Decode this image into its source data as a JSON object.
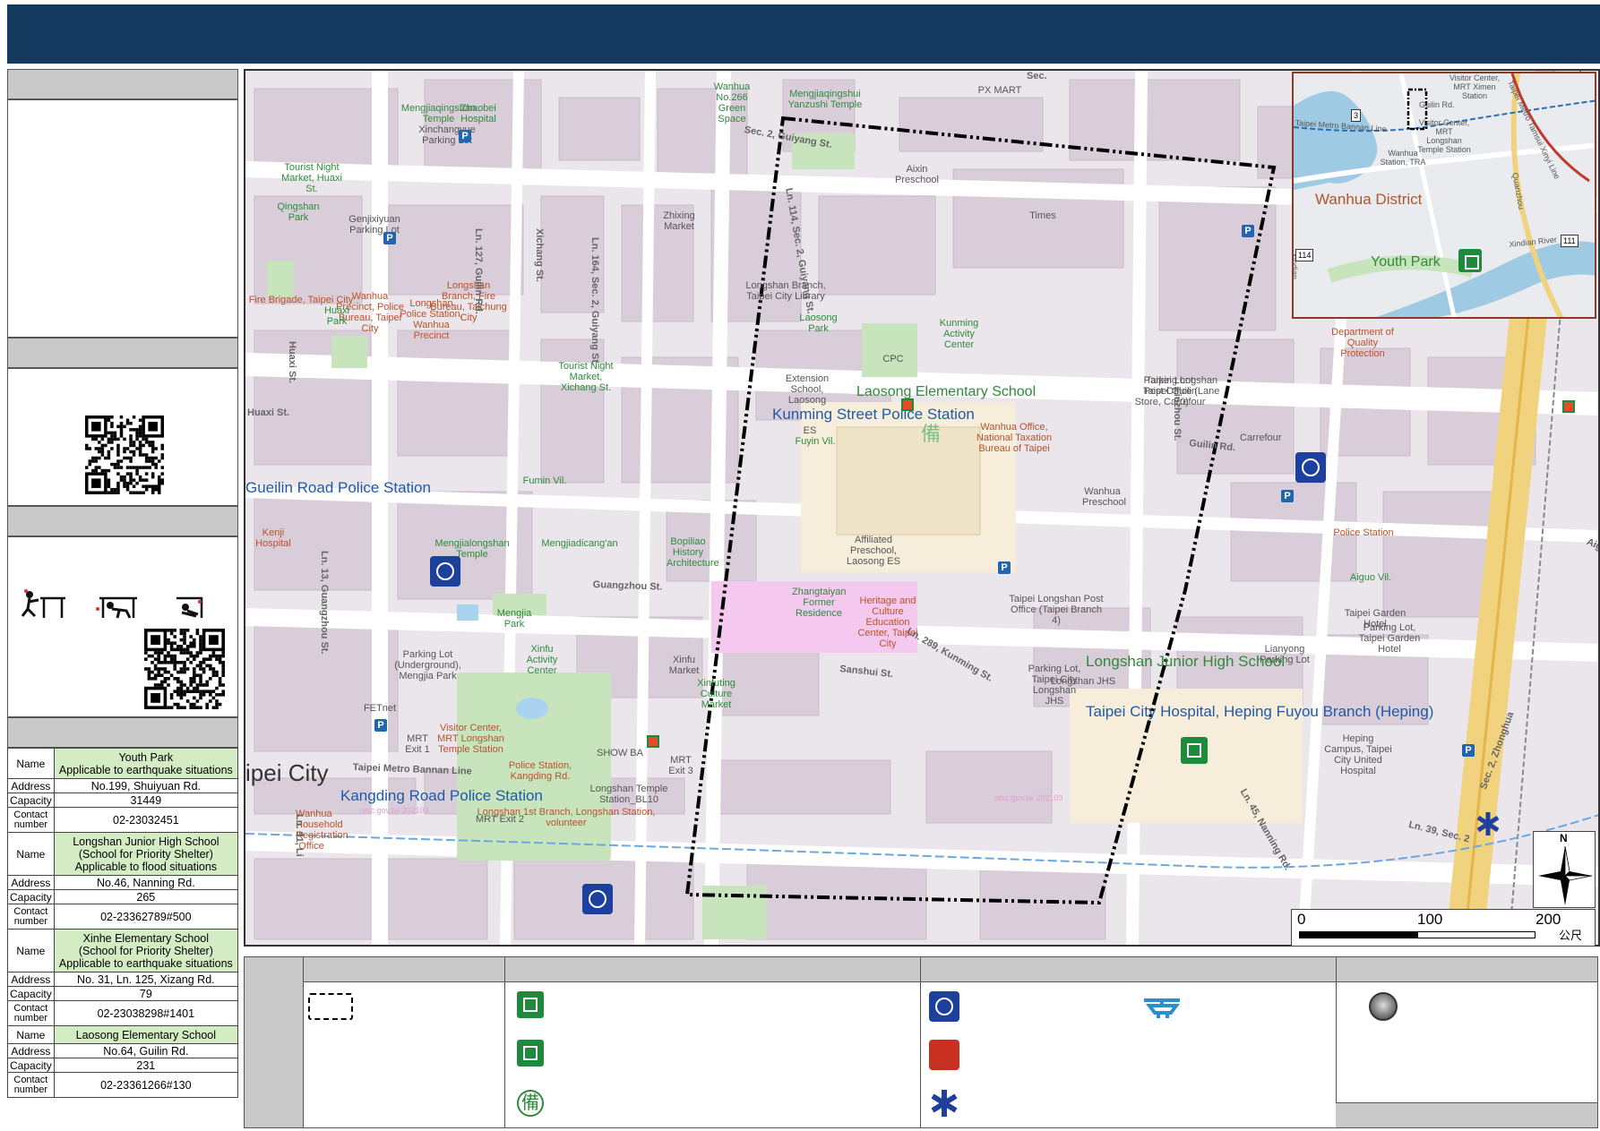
{
  "map": {
    "small_labels": [
      {
        "text": "Mengjiaqingshan Temple",
        "cls": "green"
      },
      {
        "text": "Zhaobei Hospital",
        "cls": "green"
      },
      {
        "text": "Wanhua No.266 Green Space",
        "cls": "green"
      },
      {
        "text": "Mengjiaqingshui Yanzushi Temple",
        "cls": "green"
      },
      {
        "text": "PX MART",
        "cls": "gray"
      },
      {
        "text": "Xinchangyue Parking Lot",
        "cls": "gray"
      },
      {
        "text": "Tourist Night Market, Huaxi St.",
        "cls": "green"
      },
      {
        "text": "Qingshan Park",
        "cls": "green"
      },
      {
        "text": "Genjixiyuan Parking Lot",
        "cls": "gray"
      },
      {
        "text": "Zhixing Market",
        "cls": "gray"
      },
      {
        "text": "Aixin Preschool",
        "cls": "gray"
      },
      {
        "text": "Times",
        "cls": "gray"
      },
      {
        "text": "Wanhua Precinct, Police Bureau, Taipei City",
        "cls": "brown"
      },
      {
        "text": "Longshan Branch, Fire Bureau, Taichung City",
        "cls": "brown"
      },
      {
        "text": "Longshan Police Station, Wanhua Precinct",
        "cls": "brown"
      },
      {
        "text": "Fire Brigade, Taipei City",
        "cls": "brown"
      },
      {
        "text": "Huaxi Park",
        "cls": "green"
      },
      {
        "text": "Longshan Branch, Taipei City Library",
        "cls": "gray"
      },
      {
        "text": "Laosong Park",
        "cls": "green"
      },
      {
        "text": "Kunming Activity Center",
        "cls": "green"
      },
      {
        "text": "Tourist Night Market, Xichang St.",
        "cls": "green"
      },
      {
        "text": "CPC",
        "cls": "gray"
      },
      {
        "text": "Parking Lot, Taipei Guilin Store, Carrefour",
        "cls": "gray"
      },
      {
        "text": "Wanhua Office, National Taxation Bureau of Taipei",
        "cls": "brown"
      },
      {
        "text": "Carrefour",
        "cls": "gray"
      },
      {
        "text": "Fuyin Vil.",
        "cls": "green"
      },
      {
        "text": "Fumin Vil.",
        "cls": "green"
      },
      {
        "text": "Wanhua Preschool",
        "cls": "gray"
      },
      {
        "text": "Mengjialongshan Temple",
        "cls": "green"
      },
      {
        "text": "Mengjiadicang'an",
        "cls": "green"
      },
      {
        "text": "Bopiliao History Architecture",
        "cls": "green"
      },
      {
        "text": "Affiliated Preschool, Laosong ES",
        "cls": "gray"
      },
      {
        "text": "Zhangtaiyan Former Residence",
        "cls": "green"
      },
      {
        "text": "Heritage and Culture Education Center, Taipei City",
        "cls": "brown"
      },
      {
        "text": "Taipei Longshan Post Office (Taipei Branch 4)",
        "cls": "gray"
      },
      {
        "text": "Mengjia Park",
        "cls": "green"
      },
      {
        "text": "Parking Lot (Underground), Mengjia Park",
        "cls": "gray"
      },
      {
        "text": "Xinfu Activity Center",
        "cls": "green"
      },
      {
        "text": "Xinfu Market",
        "cls": "gray"
      },
      {
        "text": "Xinfuting Culture Market",
        "cls": "green"
      },
      {
        "text": "FETnet",
        "cls": "gray"
      },
      {
        "text": "Visitor Center, MRT Longshan Temple Station",
        "cls": "brown"
      },
      {
        "text": "MRT Exit 1",
        "cls": "gray"
      },
      {
        "text": "MRT Exit 3",
        "cls": "gray"
      },
      {
        "text": "SHOW BA",
        "cls": "gray"
      },
      {
        "text": "Police Station, Kangding Rd.",
        "cls": "brown"
      },
      {
        "text": "Longshan Temple Station_BL10",
        "cls": "gray"
      },
      {
        "text": "Longshan 1st Branch, Longshan Station, volunteer",
        "cls": "brown"
      },
      {
        "text": "Wanhua Household Registration Office",
        "cls": "brown"
      },
      {
        "text": "MRT Exit 2",
        "cls": "gray"
      },
      {
        "text": "Longshan JHS",
        "cls": "gray"
      },
      {
        "text": "Parking Lot, Taipei City Longshan JHS",
        "cls": "gray"
      },
      {
        "text": "Lianyong Parking Lot",
        "cls": "gray"
      },
      {
        "text": "Taipei Garden Hotel",
        "cls": "gray"
      },
      {
        "text": "Parking Lot, Taipei Garden Hotel",
        "cls": "gray"
      },
      {
        "text": "Aiguo Vil.",
        "cls": "green"
      },
      {
        "text": "Heping Campus, Taipei City United Hospital",
        "cls": "gray"
      },
      {
        "text": "Department of Quality Protection",
        "cls": "brown"
      },
      {
        "text": "Extension School, Laosong",
        "cls": "gray"
      },
      {
        "text": "Kenji Hospital",
        "cls": "brown"
      },
      {
        "text": "Police Station",
        "cls": "brown"
      },
      {
        "text": "Taipei Longshan Post Office (Lane 70)",
        "cls": "gray"
      },
      {
        "text": "ES",
        "cls": "gray"
      }
    ],
    "street_labels": [
      {
        "text": "Sec. 2, Guiyang St."
      },
      {
        "text": "Ln. 114, Sec. 2, Guiyang St."
      },
      {
        "text": "Ln. 127, Guilin Rd."
      },
      {
        "text": "Xichang St."
      },
      {
        "text": "Ln. 164, Sec. 2, Guiyang St."
      },
      {
        "text": "Huaxi St."
      },
      {
        "text": "Huaxi St."
      },
      {
        "text": "Guilin Rd."
      },
      {
        "text": "Liuzhou St."
      },
      {
        "text": "Guangzhou St."
      },
      {
        "text": "Ln. 13, Guangzhou St."
      },
      {
        "text": "Ln. 289, Kunming St."
      },
      {
        "text": "Sanshui St."
      },
      {
        "text": "Ln. 45, Nanning Rd."
      },
      {
        "text": "Taipei Metro Bannan Line"
      },
      {
        "text": "Ln. 91, Li"
      },
      {
        "text": "Ln. 39, Sec. 2"
      },
      {
        "text": "Sec. 2, Zhonghua"
      },
      {
        "text": "Aiguo"
      },
      {
        "text": "Sec."
      }
    ],
    "big_labels": [
      {
        "text": "Laosong Elementary School",
        "cls": "biggreen"
      },
      {
        "text": "Kunming Street Police Station",
        "cls": "bigblue"
      },
      {
        "text": "Gueilin Road Police Station",
        "cls": "bigblue"
      },
      {
        "text": "Kangding Road Police Station",
        "cls": "bigblue"
      },
      {
        "text": "Longshan Junior High School",
        "cls": "biggreen"
      },
      {
        "text": "Taipei City Hospital, Heping Fuyou Branch (Heping)",
        "cls": "bigblue"
      },
      {
        "text": "ipei City",
        "cls": "gray"
      }
    ],
    "watermarks": [
      "nlsc.gov.tw 202103",
      "nlsc.gov.tw 202103"
    ],
    "reserve_glyph": "備"
  },
  "inset": {
    "labels": [
      {
        "text": "Visitor Center, MRT Ximen Station"
      },
      {
        "text": "Taipei Metro Bannan Line"
      },
      {
        "text": "Visitor Center, MRT Longshan Temple Station"
      },
      {
        "text": "Wanhua Station, TRA"
      },
      {
        "text": "Taipei Metro Tamsui Xinyi Line"
      },
      {
        "text": "Quanzhou"
      },
      {
        "text": "Xindian"
      },
      {
        "text": "Xindian River"
      },
      {
        "text": "Guilin Rd."
      }
    ],
    "district": "Wanhua District",
    "park": "Youth Park",
    "route_shields": [
      "3",
      "114",
      "111"
    ]
  },
  "scalebar": {
    "ticks": [
      "0",
      "100",
      "200"
    ],
    "unit": "公尺"
  },
  "north": {
    "label": "N"
  },
  "sidebar": {
    "shelters": [
      {
        "name_lines": [
          "Youth Park",
          "Applicable to earthquake situations"
        ],
        "address": "No.199, Shuiyuan Rd.",
        "capacity": "31449",
        "contact": "02-23032451"
      },
      {
        "name_lines": [
          "Longshan Junior High School",
          "(School for Priority Shelter)",
          "Applicable to flood situations"
        ],
        "address": "No.46, Nanning Rd.",
        "capacity": "265",
        "contact": "02-23362789#500"
      },
      {
        "name_lines": [
          "Xinhe Elementary School",
          "(School for Priority Shelter)",
          "Applicable to earthquake situations"
        ],
        "address": "No. 31, Ln. 125, Xizang Rd.",
        "capacity": "79",
        "contact": "02-23038298#1401"
      },
      {
        "name_lines": [
          "Laosong Elementary School"
        ],
        "address": "No.64, Guilin Rd.",
        "capacity": "231",
        "contact": "02-23361266#130"
      }
    ],
    "keys": {
      "name": "Name",
      "address": "Address",
      "capacity": "Capacity",
      "contact": "Contact number"
    }
  },
  "legend": {
    "reserve_glyph": "備"
  },
  "colors": {
    "title_bar": "#153a60",
    "police_blue": "#1d3f9e",
    "shelter_green": "#1e8a3c",
    "boundary": "#000000"
  }
}
